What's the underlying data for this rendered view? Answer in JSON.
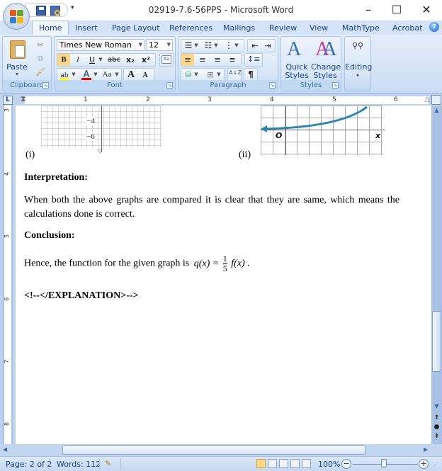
{
  "window": {
    "title": "02919-7.6-56PPS - Microsoft Word",
    "minimize_icon": "minimize-icon",
    "maximize_icon": "maximize-icon",
    "close_icon": "close-icon"
  },
  "quick_access": {
    "items": [
      "save-icon",
      "print-preview-icon",
      "customize-dropdown-icon"
    ],
    "more": "▾"
  },
  "tabs": [
    {
      "label": "Home",
      "active": true
    },
    {
      "label": "Insert"
    },
    {
      "label": "Page Layout"
    },
    {
      "label": "References"
    },
    {
      "label": "Mailings"
    },
    {
      "label": "Review"
    },
    {
      "label": "View"
    },
    {
      "label": "MathType"
    },
    {
      "label": "Acrobat"
    }
  ],
  "help_label": "?",
  "ribbon": {
    "clipboard": {
      "label": "Clipboard",
      "paste_label": "Paste",
      "paste_dd": "▾",
      "icons": [
        "cut-icon",
        "copy-icon",
        "format-painter-icon"
      ]
    },
    "font": {
      "label": "Font",
      "font_name": "Times New Roman",
      "font_size": "12",
      "bold": "B",
      "italic": "I",
      "underline": "U",
      "strike": "abc",
      "subscript": "x₂",
      "superscript": "x²",
      "change_case": "Aa",
      "grow": "A",
      "shrink": "A",
      "highlight": "ab",
      "font_color": "A",
      "highlight_color": "#ffff00",
      "font_color_value": "#e00000"
    },
    "paragraph": {
      "label": "Paragraph",
      "pilcrow": "¶",
      "sort": "A↓Z"
    },
    "styles": {
      "label": "Styles",
      "quick_styles_1": "Quick",
      "quick_styles_2": "Styles ▾",
      "change_styles_1": "Change",
      "change_styles_2": "Styles ▾"
    },
    "editing": {
      "label": "Editing",
      "dd": "▾"
    }
  },
  "ruler": {
    "marks": [
      "1",
      "2",
      "3",
      "4",
      "5",
      "6"
    ],
    "vertical_marks": [
      "3",
      "4",
      "5",
      "6",
      "7",
      "8"
    ],
    "tab_selector": "L"
  },
  "document": {
    "graph1": {
      "labels": [
        "−4",
        "−6"
      ],
      "caption": "(i)"
    },
    "graph2": {
      "origin": "O",
      "x_axis": "x",
      "caption": "(ii)"
    },
    "heading1": "Interpretation:",
    "para1": "When both the above graphs are compared it is clear that they are same, which means the calculations done is correct.",
    "heading2": "Conclusion:",
    "conclusion_text": "Hence, the function for the given graph is",
    "formula_lhs": "q(x) =",
    "formula_num": "1",
    "formula_den": "5",
    "formula_rhs": "f(x) .",
    "closing_tag": "<!--</EXPLANATION>-->"
  },
  "status": {
    "page": "Page: 2 of 2",
    "words": "Words: 112",
    "zoom": "100%",
    "zoom_percent": 100
  }
}
